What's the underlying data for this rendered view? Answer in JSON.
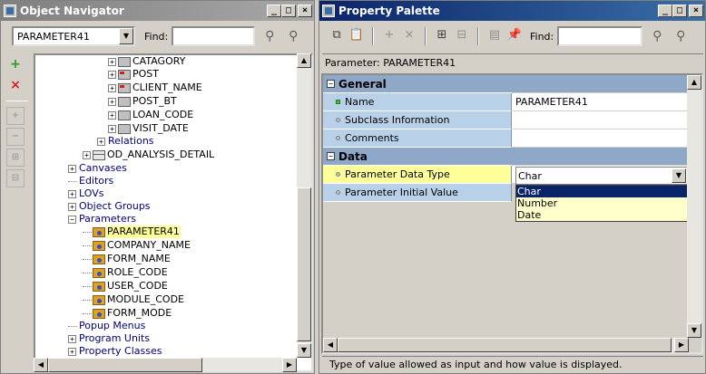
{
  "navigator": {
    "title": "Object Navigator",
    "combo_value": "PARAMETER41",
    "find_label": "Find:",
    "find_value": "",
    "tree": [
      {
        "label": "CATAGORY",
        "icon": "column-icon"
      },
      {
        "label": "POST",
        "icon": "key-column-icon"
      },
      {
        "label": "CLIENT_NAME",
        "icon": "key-column-icon"
      },
      {
        "label": "POST_BT",
        "icon": "column-icon"
      },
      {
        "label": "LOAN_CODE",
        "icon": "column-icon"
      },
      {
        "label": "VISIT_DATE",
        "icon": "column-icon"
      },
      {
        "label": "Relations"
      },
      {
        "label": "OD_ANALYSIS_DETAIL",
        "icon": "table-icon"
      },
      {
        "label": "Canvases"
      },
      {
        "label": "Editors"
      },
      {
        "label": "LOVs"
      },
      {
        "label": "Object Groups"
      },
      {
        "label": "Parameters"
      },
      {
        "label": "PARAMETER41",
        "icon": "parameter-icon"
      },
      {
        "label": "COMPANY_NAME",
        "icon": "parameter-icon"
      },
      {
        "label": "FORM_NAME",
        "icon": "parameter-icon"
      },
      {
        "label": "ROLE_CODE",
        "icon": "parameter-icon"
      },
      {
        "label": "USER_CODE",
        "icon": "parameter-icon"
      },
      {
        "label": "MODULE_CODE",
        "icon": "parameter-icon"
      },
      {
        "label": "FORM_MODE",
        "icon": "parameter-icon"
      },
      {
        "label": "Popup Menus"
      },
      {
        "label": "Program Units"
      },
      {
        "label": "Property Classes"
      }
    ]
  },
  "palette": {
    "title": "Property Palette",
    "find_label": "Find:",
    "find_value": "",
    "header": "Parameter: PARAMETER41",
    "categories": {
      "general": "General",
      "data": "Data"
    },
    "properties": {
      "name_label": "Name",
      "name_value": "PARAMETER41",
      "subclass_label": "Subclass Information",
      "subclass_value": "",
      "comments_label": "Comments",
      "comments_value": "",
      "data_type_label": "Parameter Data Type",
      "data_type_value": "Char",
      "initial_value_label": "Parameter Initial Value"
    },
    "dropdown_options": [
      "Char",
      "Number",
      "Date"
    ],
    "status": "Type of value allowed as input and how value is displayed."
  },
  "colors": {
    "active_title": "#0a246a",
    "inactive_title": "#808080",
    "selection": "#ffff99",
    "category": "#90a8c8",
    "property_label": "#b8d0e8"
  }
}
